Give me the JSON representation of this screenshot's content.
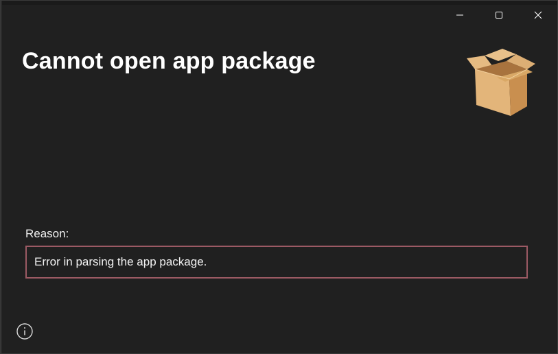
{
  "window": {
    "title": "Cannot open app package",
    "controls": {
      "minimize_icon": "minimize-icon",
      "maximize_icon": "maximize-icon",
      "close_icon": "close-icon"
    }
  },
  "illustration": {
    "icon": "open-box-icon"
  },
  "reason": {
    "label": "Reason:",
    "text": "Error in parsing the app package."
  },
  "footer": {
    "info_icon": "info-icon"
  },
  "colors": {
    "background": "#202020",
    "reason_border": "#9c5a64",
    "box_light": "#e3b57a",
    "box_dark": "#c98f4f"
  }
}
